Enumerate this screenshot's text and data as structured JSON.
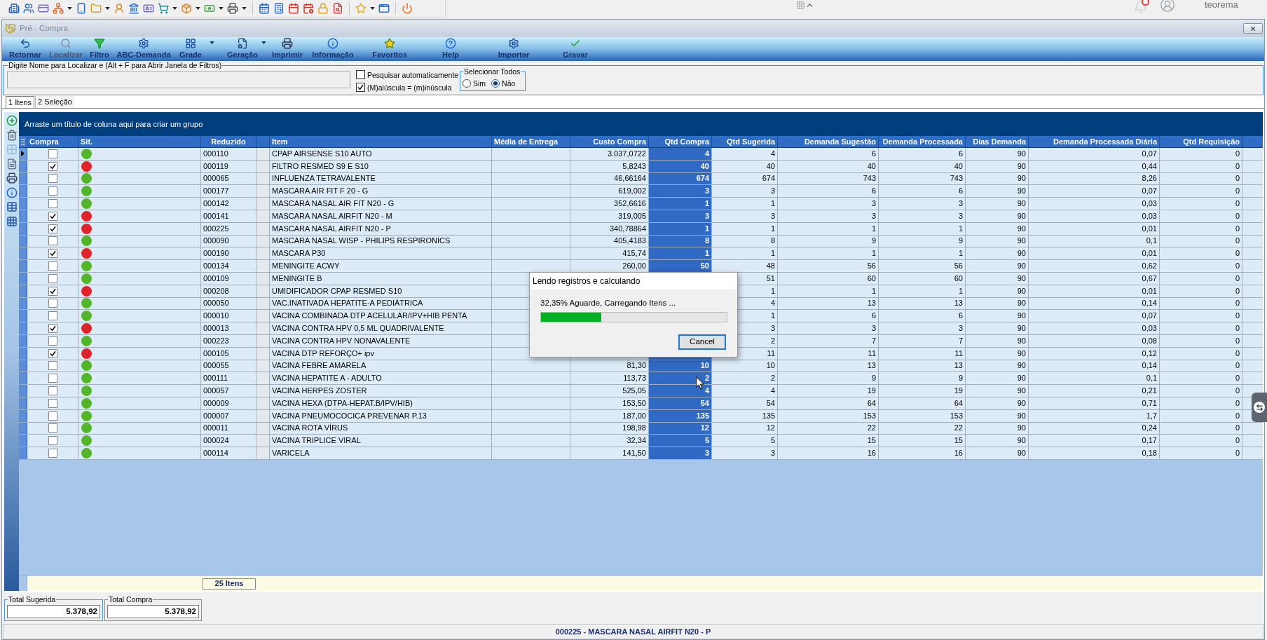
{
  "app_bar": {
    "user": "teorema"
  },
  "window": {
    "title": "Pré - Compra"
  },
  "toolbar": [
    {
      "label": "Retornar",
      "disabled": false,
      "menu": false
    },
    {
      "label": "Localizar",
      "disabled": true,
      "menu": false
    },
    {
      "label": "Filtro",
      "disabled": false,
      "menu": false
    },
    {
      "label": "ABC-Demanda",
      "disabled": false,
      "menu": false
    },
    {
      "label": "Grade",
      "disabled": false,
      "menu": true
    },
    {
      "label": "Geração",
      "disabled": false,
      "menu": true
    },
    {
      "label": "Imprimir",
      "disabled": false,
      "menu": false
    },
    {
      "label": "Informação",
      "disabled": false,
      "menu": false
    },
    {
      "label": "Favoritos",
      "disabled": false,
      "menu": false
    },
    {
      "label": "Help",
      "disabled": false,
      "menu": false
    },
    {
      "label": "Importar",
      "disabled": false,
      "menu": false
    },
    {
      "label": "Gravar",
      "disabled": false,
      "menu": false
    }
  ],
  "filter": {
    "label": "Digite Nome para Localizar e (Alt + F para Abrir Janela de Filtros)",
    "options": [
      {
        "label": "Pesquisar automaticamente",
        "checked": false
      },
      {
        "label": "(M)aiúscula = (m)inúscula",
        "checked": true
      }
    ],
    "select_all": {
      "label": "Selecionar Todos",
      "options": [
        {
          "label": "Sim",
          "selected": false
        },
        {
          "label": "Não",
          "selected": true
        }
      ]
    }
  },
  "tabs": [
    {
      "label": "1 Itens",
      "selected": true
    },
    {
      "label": "2 Seleção",
      "selected": false
    }
  ],
  "grid": {
    "group_hint": "Arraste um título de coluna aqui para criar um grupo",
    "columns": [
      "Compra",
      "Sit.",
      "Reduzido",
      "Item",
      "Média de Entrega",
      "Custo Compra",
      "Qtd Compra",
      "Qtd Sugerida",
      "Demanda Sugestão",
      "Demanda Processada",
      "Dias Demanda",
      "Demanda Processada Diária",
      "Qtd Requisição"
    ],
    "rows": [
      {
        "selected": true,
        "checked": false,
        "color": "#52b52a",
        "reduzido": "000110",
        "item": "CPAP AIRSENSE S10 AUTO",
        "custo_compra": "3.037,0722",
        "qtd_compra": "4",
        "qtd_sugerida": "4",
        "demanda_sugestao": "6",
        "demanda_processada": "6",
        "dias_demanda": "90",
        "demanda_processada_diaria": "0,07",
        "qtd_requisicao": "0"
      },
      {
        "selected": false,
        "checked": true,
        "color": "#e0232a",
        "reduzido": "000119",
        "item": "FILTRO RESMED S9 E S10",
        "custo_compra": "5,8243",
        "qtd_compra": "40",
        "qtd_sugerida": "40",
        "demanda_sugestao": "40",
        "demanda_processada": "40",
        "dias_demanda": "90",
        "demanda_processada_diaria": "0,44",
        "qtd_requisicao": "0"
      },
      {
        "selected": false,
        "checked": false,
        "color": "#52b52a",
        "reduzido": "000065",
        "item": "INFLUENZA TETRAVALENTE",
        "custo_compra": "46,66164",
        "qtd_compra": "674",
        "qtd_sugerida": "674",
        "demanda_sugestao": "743",
        "demanda_processada": "743",
        "dias_demanda": "90",
        "demanda_processada_diaria": "8,26",
        "qtd_requisicao": "0"
      },
      {
        "selected": false,
        "checked": false,
        "color": "#52b52a",
        "reduzido": "000177",
        "item": "MASCARA AIR FIT F 20 - G",
        "custo_compra": "619,002",
        "qtd_compra": "3",
        "qtd_sugerida": "3",
        "demanda_sugestao": "6",
        "demanda_processada": "6",
        "dias_demanda": "90",
        "demanda_processada_diaria": "0,07",
        "qtd_requisicao": "0"
      },
      {
        "selected": false,
        "checked": false,
        "color": "#52b52a",
        "reduzido": "000142",
        "item": "MASCARA NASAL AIR FIT N20 - G",
        "custo_compra": "352,6616",
        "qtd_compra": "1",
        "qtd_sugerida": "1",
        "demanda_sugestao": "3",
        "demanda_processada": "3",
        "dias_demanda": "90",
        "demanda_processada_diaria": "0,03",
        "qtd_requisicao": "0"
      },
      {
        "selected": false,
        "checked": true,
        "color": "#e0232a",
        "reduzido": "000141",
        "item": "MASCARA NASAL AIRFIT N20 - M",
        "custo_compra": "319,005",
        "qtd_compra": "3",
        "qtd_sugerida": "3",
        "demanda_sugestao": "3",
        "demanda_processada": "3",
        "dias_demanda": "90",
        "demanda_processada_diaria": "0,03",
        "qtd_requisicao": "0"
      },
      {
        "selected": false,
        "checked": true,
        "color": "#e0232a",
        "reduzido": "000225",
        "item": "MASCARA NASAL AIRFIT N20 - P",
        "custo_compra": "340,78864",
        "qtd_compra": "1",
        "qtd_sugerida": "1",
        "demanda_sugestao": "1",
        "demanda_processada": "1",
        "dias_demanda": "90",
        "demanda_processada_diaria": "0,01",
        "qtd_requisicao": "0"
      },
      {
        "selected": false,
        "checked": false,
        "color": "#52b52a",
        "reduzido": "000090",
        "item": "MASCARA NASAL WISP - PHILIPS RESPIRONICS",
        "custo_compra": "405,4183",
        "qtd_compra": "8",
        "qtd_sugerida": "8",
        "demanda_sugestao": "9",
        "demanda_processada": "9",
        "dias_demanda": "90",
        "demanda_processada_diaria": "0,1",
        "qtd_requisicao": "0"
      },
      {
        "selected": false,
        "checked": true,
        "color": "#e0232a",
        "reduzido": "000190",
        "item": "MASCARA P30",
        "custo_compra": "415,74",
        "qtd_compra": "1",
        "qtd_sugerida": "1",
        "demanda_sugestao": "1",
        "demanda_processada": "1",
        "dias_demanda": "90",
        "demanda_processada_diaria": "0,01",
        "qtd_requisicao": "0"
      },
      {
        "selected": false,
        "checked": false,
        "color": "#52b52a",
        "reduzido": "000134",
        "item": "MENINGITE ACWY",
        "custo_compra": "260,00",
        "qtd_compra": "50",
        "qtd_sugerida": "48",
        "demanda_sugestao": "56",
        "demanda_processada": "56",
        "dias_demanda": "90",
        "demanda_processada_diaria": "0,62",
        "qtd_requisicao": "0"
      },
      {
        "selected": false,
        "checked": false,
        "color": "#52b52a",
        "reduzido": "000109",
        "item": "MENINGITE B",
        "qtd_sugerida": "51",
        "demanda_sugestao": "60",
        "demanda_processada": "60",
        "dias_demanda": "90",
        "demanda_processada_diaria": "0,67",
        "qtd_requisicao": "0"
      },
      {
        "selected": false,
        "checked": true,
        "color": "#e0232a",
        "reduzido": "000208",
        "item": "UMIDIFICADOR CPAP RESMED S10",
        "qtd_sugerida": "1",
        "demanda_sugestao": "1",
        "demanda_processada": "1",
        "dias_demanda": "90",
        "demanda_processada_diaria": "0,01",
        "qtd_requisicao": "0"
      },
      {
        "selected": false,
        "checked": false,
        "color": "#52b52a",
        "reduzido": "000050",
        "item": "VAC.INATIVADA HEPATITE-A PEDIÁTRICA",
        "qtd_sugerida": "4",
        "demanda_sugestao": "13",
        "demanda_processada": "13",
        "dias_demanda": "90",
        "demanda_processada_diaria": "0,14",
        "qtd_requisicao": "0"
      },
      {
        "selected": false,
        "checked": false,
        "color": "#52b52a",
        "reduzido": "000010",
        "item": "VACINA COMBINADA DTP ACELULAR/IPV+HIB PENTA",
        "qtd_sugerida": "1",
        "demanda_sugestao": "6",
        "demanda_processada": "6",
        "dias_demanda": "90",
        "demanda_processada_diaria": "0,07",
        "qtd_requisicao": "0"
      },
      {
        "selected": false,
        "checked": true,
        "color": "#e0232a",
        "reduzido": "000013",
        "item": "VACINA CONTRA HPV 0,5 ML QUADRIVALENTE",
        "qtd_sugerida": "3",
        "demanda_sugestao": "3",
        "demanda_processada": "3",
        "dias_demanda": "90",
        "demanda_processada_diaria": "0,03",
        "qtd_requisicao": "0"
      },
      {
        "selected": false,
        "checked": false,
        "color": "#52b52a",
        "reduzido": "000223",
        "item": "VACINA CONTRA HPV NONAVALENTE",
        "qtd_sugerida": "2",
        "demanda_sugestao": "7",
        "demanda_processada": "7",
        "dias_demanda": "90",
        "demanda_processada_diaria": "0,08",
        "qtd_requisicao": "0"
      },
      {
        "selected": false,
        "checked": true,
        "color": "#e0232a",
        "reduzido": "000105",
        "item": "VACINA DTP REFORÇO+ ipv",
        "qtd_sugerida": "11",
        "demanda_sugestao": "11",
        "demanda_processada": "11",
        "dias_demanda": "90",
        "demanda_processada_diaria": "0,12",
        "qtd_requisicao": "0"
      },
      {
        "selected": false,
        "checked": false,
        "color": "#52b52a",
        "reduzido": "000055",
        "item": "VACINA FEBRE AMARELA",
        "custo_compra": "81,30",
        "qtd_compra": "10",
        "qtd_sugerida": "10",
        "demanda_sugestao": "13",
        "demanda_processada": "13",
        "dias_demanda": "90",
        "demanda_processada_diaria": "0,14",
        "qtd_requisicao": "0"
      },
      {
        "selected": false,
        "checked": false,
        "color": "#52b52a",
        "reduzido": "000111",
        "item": "VACINA HEPATITE A - ADULTO",
        "custo_compra": "113,73",
        "qtd_compra": "2",
        "qtd_sugerida": "2",
        "demanda_sugestao": "9",
        "demanda_processada": "9",
        "dias_demanda": "90",
        "demanda_processada_diaria": "0,1",
        "qtd_requisicao": "0"
      },
      {
        "selected": false,
        "checked": false,
        "color": "#52b52a",
        "reduzido": "000057",
        "item": "VACINA HERPES ZOSTER",
        "custo_compra": "525,05",
        "qtd_compra": "4",
        "qtd_sugerida": "4",
        "demanda_sugestao": "19",
        "demanda_processada": "19",
        "dias_demanda": "90",
        "demanda_processada_diaria": "0,21",
        "qtd_requisicao": "0"
      },
      {
        "selected": false,
        "checked": false,
        "color": "#52b52a",
        "reduzido": "000009",
        "item": "VACINA HEXA (DTPA-HEPAT.B/IPV/HIB)",
        "custo_compra": "153,50",
        "qtd_compra": "54",
        "qtd_sugerida": "54",
        "demanda_sugestao": "64",
        "demanda_processada": "64",
        "dias_demanda": "90",
        "demanda_processada_diaria": "0,71",
        "qtd_requisicao": "0"
      },
      {
        "selected": false,
        "checked": false,
        "color": "#52b52a",
        "reduzido": "000007",
        "item": "VACINA PNEUMOCOCICA PREVENAR P.13",
        "custo_compra": "187,00",
        "qtd_compra": "135",
        "qtd_sugerida": "135",
        "demanda_sugestao": "153",
        "demanda_processada": "153",
        "dias_demanda": "90",
        "demanda_processada_diaria": "1,7",
        "qtd_requisicao": "0"
      },
      {
        "selected": false,
        "checked": false,
        "color": "#52b52a",
        "reduzido": "000011",
        "item": "VACINA ROTA VÍRUS",
        "custo_compra": "198,98",
        "qtd_compra": "12",
        "qtd_sugerida": "12",
        "demanda_sugestao": "22",
        "demanda_processada": "22",
        "dias_demanda": "90",
        "demanda_processada_diaria": "0,24",
        "qtd_requisicao": "0"
      },
      {
        "selected": false,
        "checked": false,
        "color": "#52b52a",
        "reduzido": "000024",
        "item": "VACINA TRIPLICE VIRAL",
        "custo_compra": "32,34",
        "qtd_compra": "5",
        "qtd_sugerida": "5",
        "demanda_sugestao": "15",
        "demanda_processada": "15",
        "dias_demanda": "90",
        "demanda_processada_diaria": "0,17",
        "qtd_requisicao": "0"
      },
      {
        "selected": false,
        "checked": false,
        "color": "#52b52a",
        "reduzido": "000114",
        "item": "VARICELA",
        "custo_compra": "141,50",
        "qtd_compra": "3",
        "qtd_sugerida": "3",
        "demanda_sugestao": "16",
        "demanda_processada": "16",
        "dias_demanda": "90",
        "demanda_processada_diaria": "0,18",
        "qtd_requisicao": "0"
      }
    ],
    "footer_count": "25 Itens"
  },
  "totals": [
    {
      "label": "Total Sugerida",
      "value": "5.378,92"
    },
    {
      "label": "Total Compra",
      "value": "5.378,92"
    }
  ],
  "status_bar": "000225 - MASCARA NASAL AIRFIT N20 - P",
  "dialog": {
    "title": "Lendo registros e calculando",
    "message": "32,35% Aguarde, Carregando Itens ...",
    "level": 0.3235,
    "button": "Cancel"
  }
}
